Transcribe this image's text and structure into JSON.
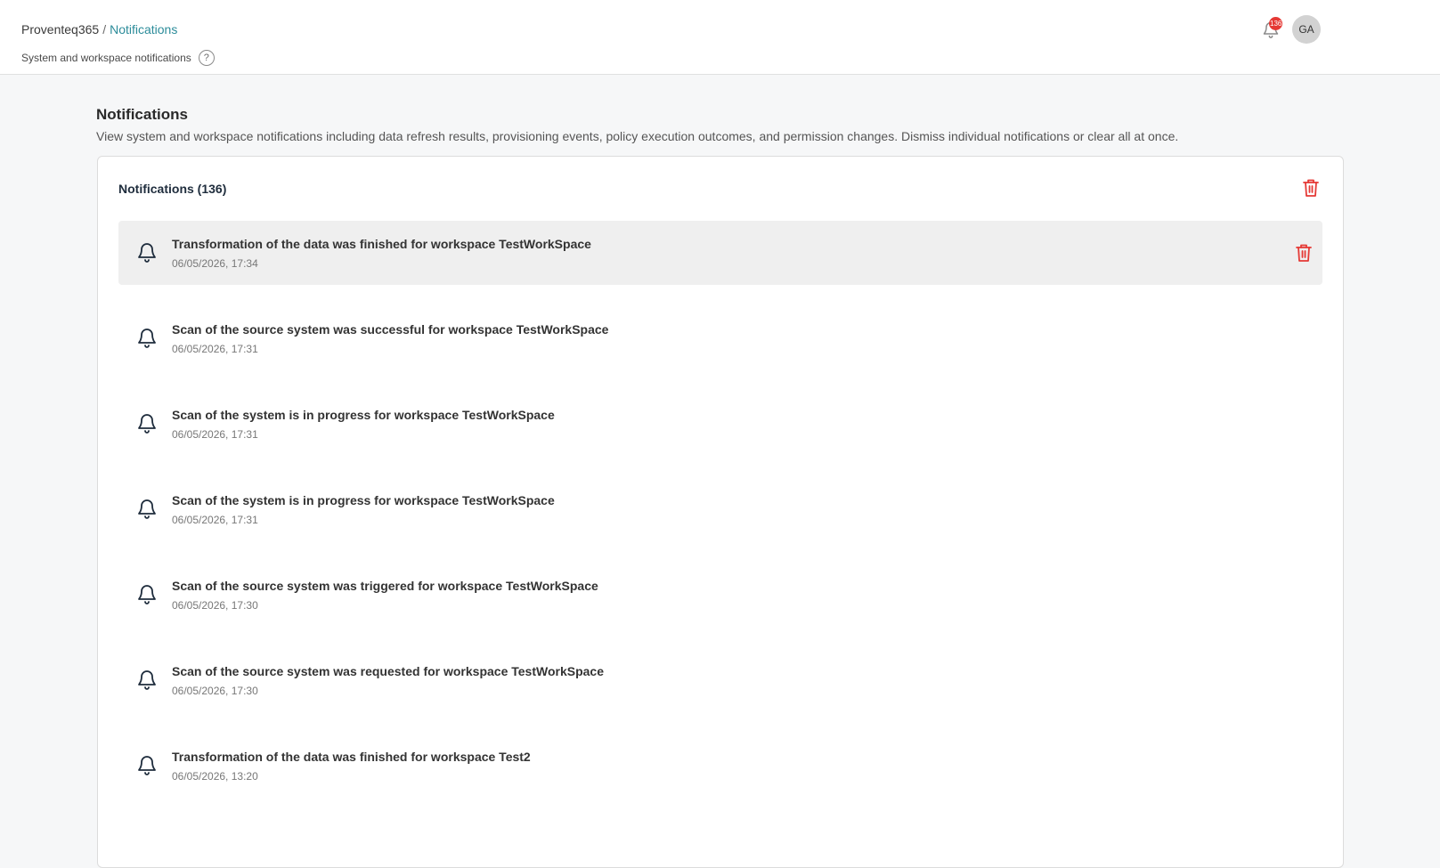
{
  "header": {
    "breadcrumb_root": "Proventeq365",
    "breadcrumb_sep": "/",
    "breadcrumb_current": "Notifications",
    "subtitle": "System and workspace notifications",
    "help_symbol": "?",
    "notification_badge": "136",
    "avatar_initials": "GA"
  },
  "page": {
    "title": "Notifications",
    "description": "View system and workspace notifications including data refresh results, provisioning events, policy execution outcomes, and permission changes. Dismiss individual notifications or clear all at once."
  },
  "card": {
    "title": "Notifications (136)"
  },
  "notifications": [
    {
      "message": "Transformation of the data was finished for workspace TestWorkSpace",
      "timestamp": "06/05/2026, 17:34"
    },
    {
      "message": "Scan of the source system was successful for workspace TestWorkSpace",
      "timestamp": "06/05/2026, 17:31"
    },
    {
      "message": "Scan of the system is in progress for workspace TestWorkSpace",
      "timestamp": "06/05/2026, 17:31"
    },
    {
      "message": "Scan of the system is in progress for workspace TestWorkSpace",
      "timestamp": "06/05/2026, 17:31"
    },
    {
      "message": "Scan of the source system was triggered for workspace TestWorkSpace",
      "timestamp": "06/05/2026, 17:30"
    },
    {
      "message": "Scan of the source system was requested for workspace TestWorkSpace",
      "timestamp": "06/05/2026, 17:30"
    },
    {
      "message": "Transformation of the data was finished for workspace Test2",
      "timestamp": "06/05/2026, 13:20"
    }
  ],
  "colors": {
    "accent": "#2c8c9a",
    "danger": "#e53935",
    "hover_row": "#efefef"
  },
  "icons": {
    "notification": "bell-icon",
    "delete": "trash-icon",
    "help": "help-icon"
  }
}
